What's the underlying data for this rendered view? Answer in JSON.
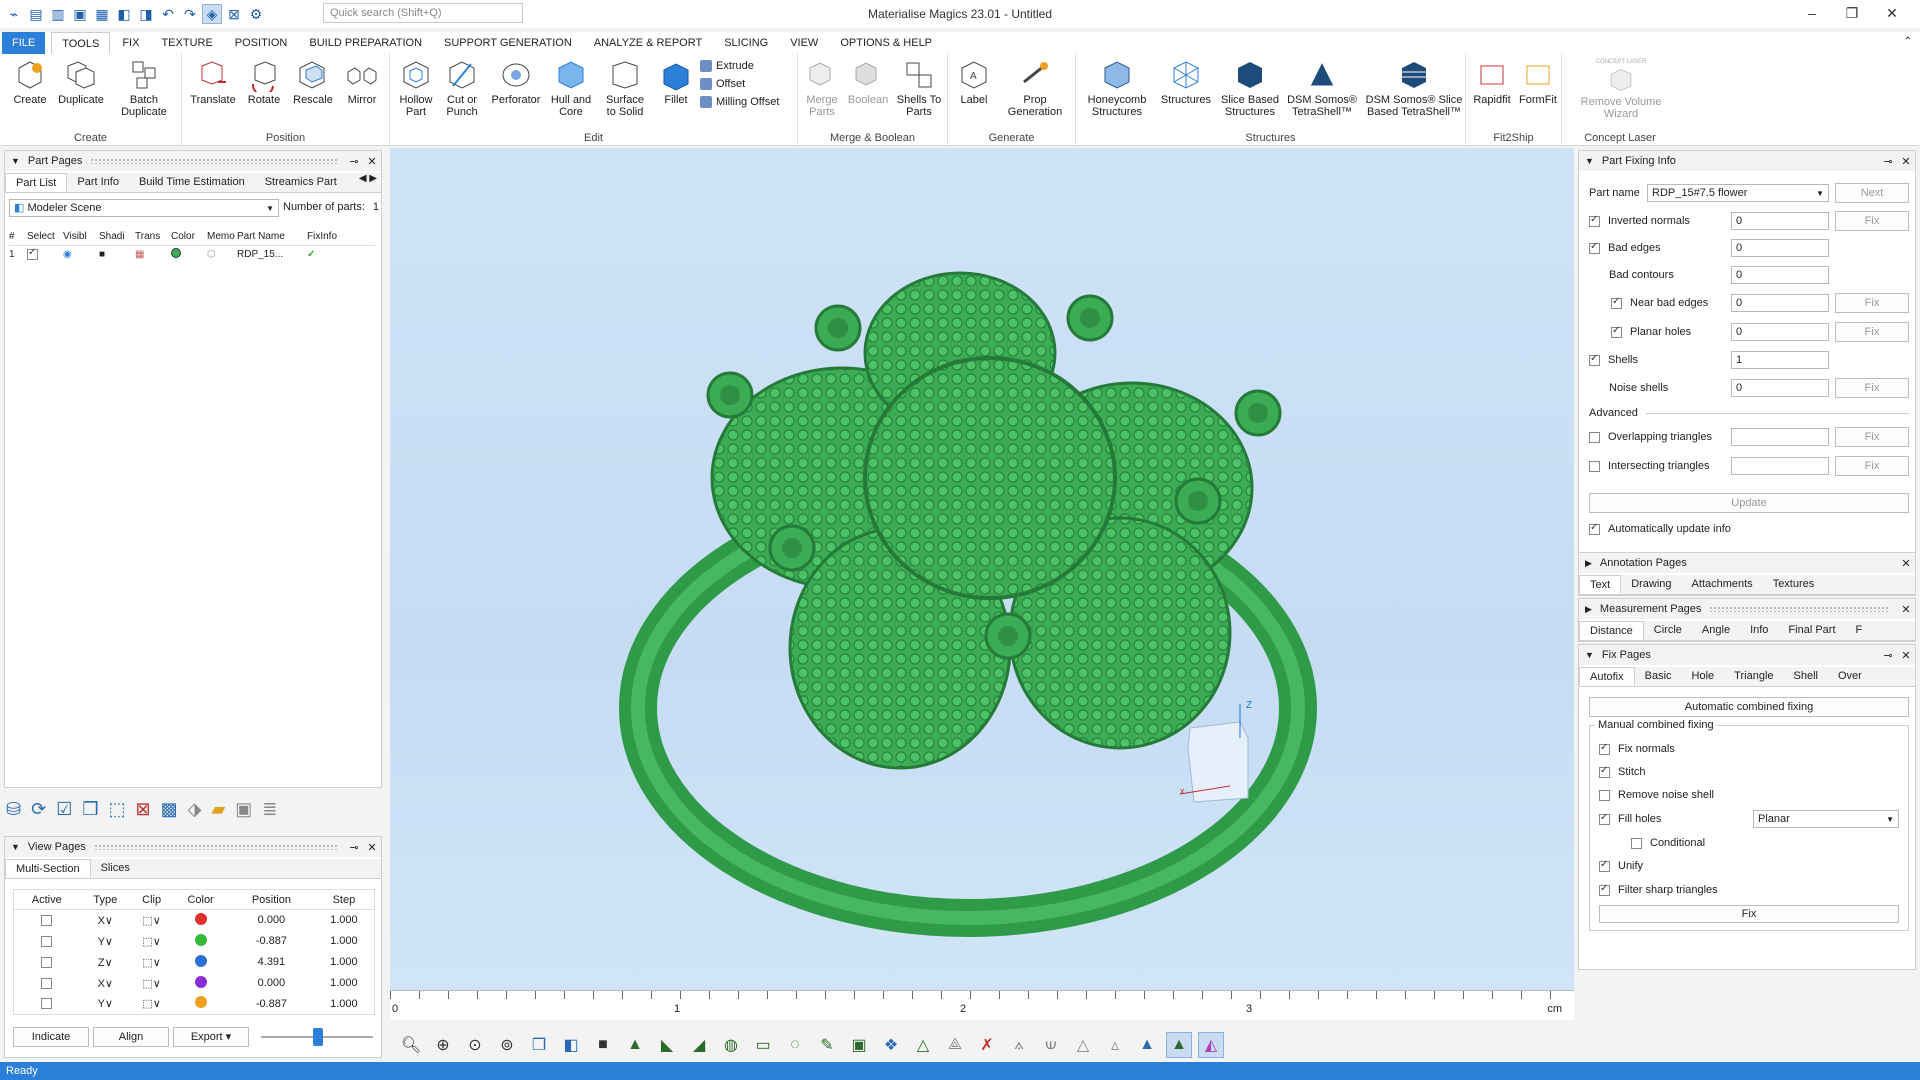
{
  "app": {
    "title": "Materialise Magics 23.01 - Untitled",
    "search_placeholder": "Quick search (Shift+Q)"
  },
  "menu": {
    "tabs": [
      "FILE",
      "TOOLS",
      "FIX",
      "TEXTURE",
      "POSITION",
      "BUILD PREPARATION",
      "SUPPORT GENERATION",
      "ANALYZE & REPORT",
      "SLICING",
      "VIEW",
      "OPTIONS & HELP"
    ],
    "active": "TOOLS"
  },
  "ribbon": {
    "create": {
      "label": "Create",
      "buttons": [
        "Create",
        "Duplicate",
        "Batch Duplicate"
      ]
    },
    "position": {
      "label": "Position",
      "buttons": [
        "Translate",
        "Rotate",
        "Rescale",
        "Mirror"
      ]
    },
    "edit": {
      "label": "Edit",
      "buttons": [
        "Hollow Part",
        "Cut or Punch",
        "Perforator",
        "Hull and Core",
        "Surface to Solid",
        "Fillet"
      ],
      "small": [
        "Extrude",
        "Offset",
        "Milling Offset"
      ]
    },
    "merge": {
      "label": "Merge & Boolean",
      "buttons": [
        "Merge Parts",
        "Boolean",
        "Shells To Parts"
      ]
    },
    "generate": {
      "label": "Generate",
      "buttons": [
        "Label",
        "Prop Generation"
      ]
    },
    "structures": {
      "label": "Structures",
      "buttons": [
        "Honeycomb Structures",
        "Structures",
        "Slice Based Structures",
        "DSM Somos® TetraShell™",
        "DSM Somos® Slice Based TetraShell™"
      ]
    },
    "fit2ship": {
      "label": "Fit2Ship",
      "buttons": [
        "Rapidfit",
        "FormFit"
      ]
    },
    "laser": {
      "label": "Concept Laser",
      "buttons": [
        "Remove Volume Wizard"
      ],
      "badge": "CONCEPT LASER"
    }
  },
  "part_pages": {
    "title": "Part Pages",
    "tabs": [
      "Part List",
      "Part Info",
      "Build Time Estimation",
      "Streamics Part"
    ],
    "scene": "Modeler Scene",
    "num_parts_label": "Number of parts:",
    "num_parts": "1",
    "columns": [
      "#",
      "Select",
      "Visibl",
      "Shadi",
      "Trans",
      "Color",
      "Memo",
      "Part Name",
      "FixInfo"
    ],
    "rows": [
      {
        "num": "1",
        "name": "RDP_15...",
        "color": "#3dab55"
      }
    ]
  },
  "view_pages": {
    "title": "View Pages",
    "tabs": [
      "Multi-Section",
      "Slices"
    ],
    "columns": [
      "Active",
      "Type",
      "Clip",
      "Color",
      "Position",
      "Step"
    ],
    "rows": [
      {
        "type": "X",
        "color": "#e03030",
        "position": "0.000",
        "step": "1.000"
      },
      {
        "type": "Y",
        "color": "#38b838",
        "position": "-0.887",
        "step": "1.000"
      },
      {
        "type": "Z",
        "color": "#2c6fd8",
        "position": "4.391",
        "step": "1.000"
      },
      {
        "type": "X",
        "color": "#8a2bd8",
        "position": "0.000",
        "step": "1.000"
      },
      {
        "type": "Y",
        "color": "#f0a020",
        "position": "-0.887",
        "step": "1.000"
      }
    ],
    "buttons": [
      "Indicate",
      "Align",
      "Export"
    ]
  },
  "fixing_info": {
    "title": "Part Fixing Info",
    "part_name_label": "Part name",
    "part_name": "RDP_15#7.5 flower",
    "next": "Next",
    "fix": "Fix",
    "items": [
      {
        "label": "Inverted normals",
        "value": "0"
      },
      {
        "label": "Bad edges",
        "value": "0"
      },
      {
        "label": "Bad contours",
        "value": "0"
      },
      {
        "label": "Near bad edges",
        "value": "0"
      },
      {
        "label": "Planar holes",
        "value": "0"
      },
      {
        "label": "Shells",
        "value": "1"
      },
      {
        "label": "Noise shells",
        "value": "0"
      }
    ],
    "advanced": "Advanced",
    "overlap": "Overlapping triangles",
    "intersect": "Intersecting triangles",
    "update": "Update",
    "auto": "Automatically update info"
  },
  "annotation": {
    "title": "Annotation Pages",
    "tabs": [
      "Text",
      "Drawing",
      "Attachments",
      "Textures"
    ]
  },
  "measurement": {
    "title": "Measurement Pages",
    "tabs": [
      "Distance",
      "Circle",
      "Angle",
      "Info",
      "Final Part",
      "F"
    ]
  },
  "fix_pages": {
    "title": "Fix Pages",
    "tabs": [
      "Autofix",
      "Basic",
      "Hole",
      "Triangle",
      "Shell",
      "Over"
    ],
    "auto_btn": "Automatic combined fixing",
    "manual": "Manual combined fixing",
    "opts": [
      "Fix normals",
      "Stitch",
      "Remove noise shell",
      "Fill holes",
      "Conditional",
      "Unify",
      "Filter sharp triangles"
    ],
    "fill_mode": "Planar",
    "fix_btn": "Fix"
  },
  "ruler": {
    "ticks": [
      "0",
      "1",
      "2",
      "3"
    ],
    "unit": "cm"
  },
  "status": "Ready",
  "colors": {
    "accent": "#2b7fd8",
    "model": "#3dab55"
  }
}
